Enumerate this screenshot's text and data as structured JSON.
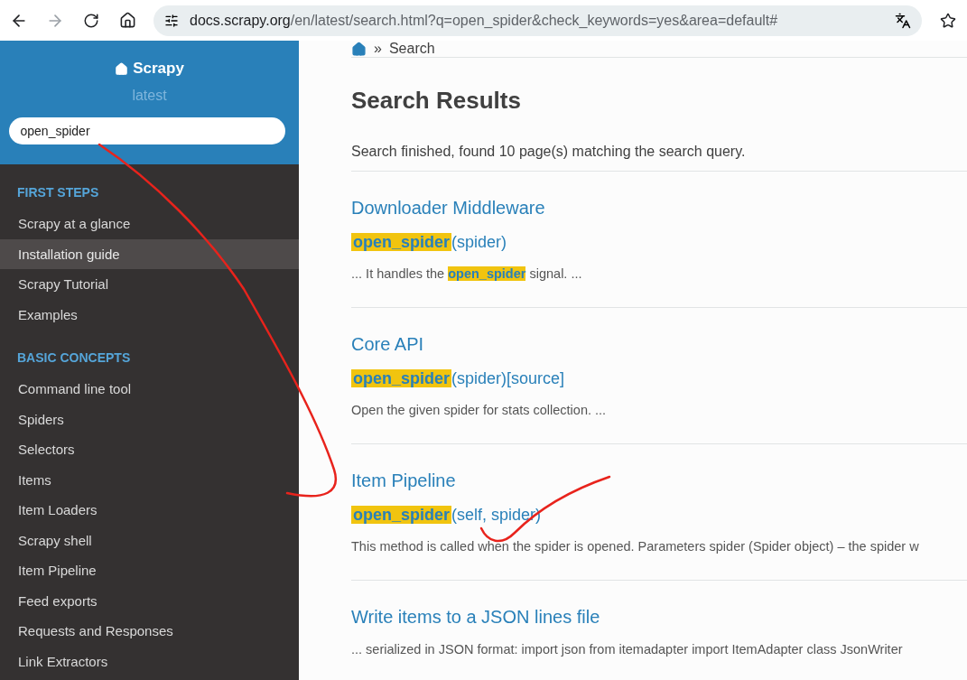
{
  "browser": {
    "back_disabled": false,
    "forward_disabled": true,
    "url": {
      "host": "docs.scrapy.org",
      "path": "/en/latest/search.html?q=open_spider&check_keywords=yes&area=default#"
    }
  },
  "sidebar": {
    "project": "Scrapy",
    "version": "latest",
    "search": {
      "value": "open_spider"
    },
    "sections": [
      {
        "caption": "FIRST STEPS",
        "items": [
          {
            "label": "Scrapy at a glance",
            "selected": false
          },
          {
            "label": "Installation guide",
            "selected": true
          },
          {
            "label": "Scrapy Tutorial",
            "selected": false
          },
          {
            "label": "Examples",
            "selected": false
          }
        ]
      },
      {
        "caption": "BASIC CONCEPTS",
        "items": [
          {
            "label": "Command line tool",
            "selected": false
          },
          {
            "label": "Spiders",
            "selected": false
          },
          {
            "label": "Selectors",
            "selected": false
          },
          {
            "label": "Items",
            "selected": false
          },
          {
            "label": "Item Loaders",
            "selected": false
          },
          {
            "label": "Scrapy shell",
            "selected": false
          },
          {
            "label": "Item Pipeline",
            "selected": false
          },
          {
            "label": "Feed exports",
            "selected": false
          },
          {
            "label": "Requests and Responses",
            "selected": false
          },
          {
            "label": "Link Extractors",
            "selected": false
          }
        ]
      }
    ]
  },
  "breadcrumb": {
    "separator": "»",
    "current": "Search"
  },
  "heading": "Search Results",
  "status": "Search finished, found 10 page(s) matching the search query.",
  "results": [
    {
      "title": "Downloader Middleware",
      "signature": {
        "name": "open_spider",
        "args": "(spider)"
      },
      "summary": [
        {
          "text": "... It handles the ",
          "highlight": false
        },
        {
          "text": "open_spider",
          "highlight": true
        },
        {
          "text": " signal. ...",
          "highlight": false
        }
      ]
    },
    {
      "title": "Core API",
      "signature": {
        "name": "open_spider",
        "args": "(spider)[source]"
      },
      "summary": [
        {
          "text": "Open the given spider for stats collection. ...",
          "highlight": false
        }
      ]
    },
    {
      "title": "Item Pipeline",
      "signature": {
        "name": "open_spider",
        "args": "(self, spider)"
      },
      "summary": [
        {
          "text": "This method is called when the spider is opened. Parameters spider (Spider object) – the spider w",
          "highlight": false
        }
      ]
    },
    {
      "title": "Write items to a JSON lines file",
      "summary": [
        {
          "text": "... serialized in JSON format: import json from itemadapter import ItemAdapter class JsonWriter",
          "highlight": false
        }
      ]
    }
  ]
}
